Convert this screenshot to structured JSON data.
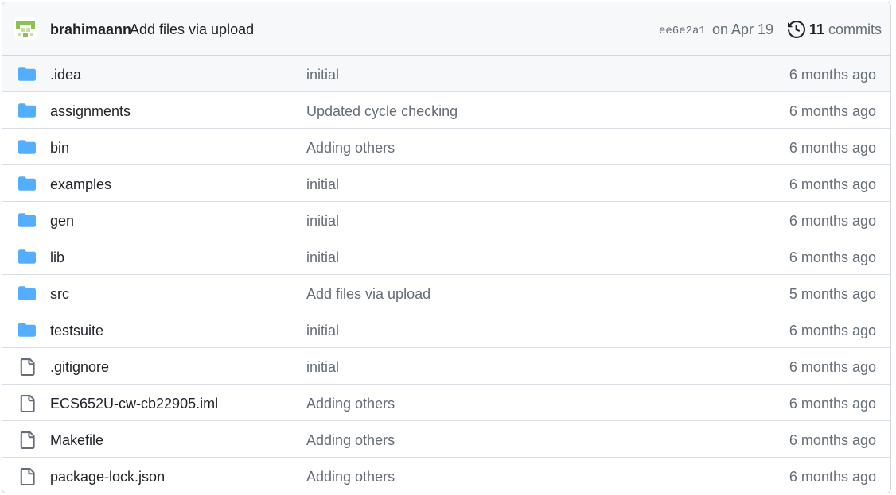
{
  "commit": {
    "author": "brahimaann",
    "message": "Add files via upload",
    "sha": "ee6e2a1",
    "date": "on Apr 19",
    "commit_count": "11",
    "commits_label": "commits"
  },
  "files": [
    {
      "name": ".idea",
      "type": "folder",
      "message": "initial",
      "age": "6 months ago"
    },
    {
      "name": "assignments",
      "type": "folder",
      "message": "Updated cycle checking",
      "age": "6 months ago"
    },
    {
      "name": "bin",
      "type": "folder",
      "message": "Adding others",
      "age": "6 months ago"
    },
    {
      "name": "examples",
      "type": "folder",
      "message": "initial",
      "age": "6 months ago"
    },
    {
      "name": "gen",
      "type": "folder",
      "message": "initial",
      "age": "6 months ago"
    },
    {
      "name": "lib",
      "type": "folder",
      "message": "initial",
      "age": "6 months ago"
    },
    {
      "name": "src",
      "type": "folder",
      "message": "Add files via upload",
      "age": "5 months ago"
    },
    {
      "name": "testsuite",
      "type": "folder",
      "message": "initial",
      "age": "6 months ago"
    },
    {
      "name": ".gitignore",
      "type": "file",
      "message": "initial",
      "age": "6 months ago"
    },
    {
      "name": "ECS652U-cw-cb22905.iml",
      "type": "file",
      "message": "Adding others",
      "age": "6 months ago"
    },
    {
      "name": "Makefile",
      "type": "file",
      "message": "Adding others",
      "age": "6 months ago"
    },
    {
      "name": "package-lock.json",
      "type": "file",
      "message": "Adding others",
      "age": "6 months ago"
    }
  ],
  "colors": {
    "folder_icon": "#54aeff",
    "file_icon": "#656d76",
    "avatar": "#8cc152"
  }
}
